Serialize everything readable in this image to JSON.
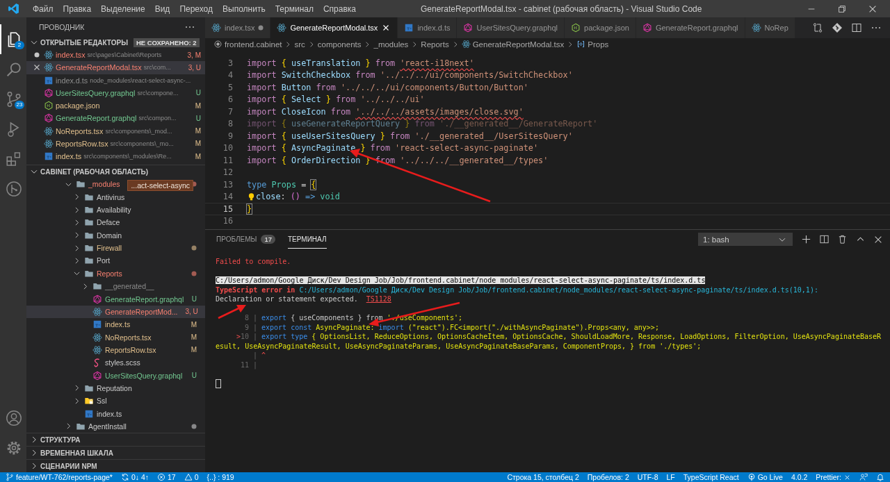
{
  "window": {
    "title": "GenerateReportModal.tsx - cabinet (рабочая область) - Visual Studio Code",
    "menu": [
      "Файл",
      "Правка",
      "Выделение",
      "Вид",
      "Переход",
      "Выполнить",
      "Терминал",
      "Справка"
    ]
  },
  "activity_bar": {
    "items": [
      {
        "selected": true,
        "badge": "2"
      },
      {
        "selected": false
      },
      {
        "selected": false,
        "badge": "23"
      },
      {
        "selected": false
      },
      {
        "selected": false
      },
      {
        "selected": false
      }
    ]
  },
  "explorer": {
    "title": "ПРОВОДНИК",
    "open_editors": {
      "title": "ОТКРЫТЫЕ РЕДАКТОРЫ",
      "expanded": true,
      "unsaved_badge": "НЕ СОХРАНЕНО: 2",
      "items": [
        {
          "name": "index.tsx",
          "path": "src\\pages\\Cabinet\\Reports",
          "kind": "react",
          "color": "#f88070",
          "badge": "3, M",
          "dirty": true,
          "selected": false
        },
        {
          "name": "GenerateReportModal.tsx",
          "path": "src\\com...",
          "kind": "react",
          "color": "#f88070",
          "badge": "3, U",
          "dirty": false,
          "selected": true
        },
        {
          "name": "index.d.ts",
          "path": "node_modules\\react-select-async-...",
          "kind": "ts",
          "color": "#8c8c8c",
          "dirty": false,
          "selected": false
        },
        {
          "name": "UserSitesQuery.graphql",
          "path": "src\\compone...",
          "kind": "graphql",
          "color": "#73c991",
          "badge": "U",
          "dirty": false,
          "selected": false
        },
        {
          "name": "package.json",
          "kind": "json",
          "color": "#e2c08d",
          "badge": "M",
          "dirty": false,
          "selected": false
        },
        {
          "name": "GenerateReport.graphql",
          "path": "src\\compon...",
          "kind": "graphql",
          "color": "#73c991",
          "badge": "U",
          "dirty": false,
          "selected": false
        },
        {
          "name": "NoReports.tsx",
          "path": "src\\components\\_mod...",
          "kind": "react",
          "color": "#e2c08d",
          "badge": "M",
          "dirty": false,
          "selected": false
        },
        {
          "name": "ReportsRow.tsx",
          "path": "src\\components\\_mo...",
          "kind": "react",
          "color": "#e2c08d",
          "badge": "M",
          "dirty": false,
          "selected": false
        },
        {
          "name": "index.ts",
          "path": "src\\components\\_modules\\Re...",
          "kind": "ts",
          "color": "#e2c08d",
          "badge": "M",
          "dirty": false,
          "selected": false
        }
      ]
    },
    "workspace": {
      "title": "CABINET (РАБОЧАЯ ОБЛАСТЬ)",
      "expanded": true,
      "tooltip": "...act-select-async",
      "tree": [
        {
          "label": "_modules",
          "kind": "folder",
          "color": "#f88070",
          "dot": true,
          "expanded": true,
          "selected": false,
          "children": [
            {
              "label": "Antivirus",
              "kind": "folder",
              "color": "#cccccc",
              "dot": false,
              "expanded": false,
              "selected": false
            },
            {
              "label": "Availability",
              "kind": "folder",
              "color": "#cccccc",
              "dot": false,
              "expanded": false,
              "selected": false
            },
            {
              "label": "Deface",
              "kind": "folder",
              "color": "#cccccc",
              "dot": false,
              "expanded": false,
              "selected": false
            },
            {
              "label": "Domain",
              "kind": "folder",
              "color": "#cccccc",
              "dot": false,
              "expanded": false,
              "selected": false
            },
            {
              "label": "Firewall",
              "kind": "folder",
              "color": "#e2c08d",
              "dot": true,
              "expanded": false,
              "selected": false
            },
            {
              "label": "Port",
              "kind": "folder",
              "color": "#cccccc",
              "dot": false,
              "expanded": false,
              "selected": false
            },
            {
              "label": "Reports",
              "kind": "folder",
              "color": "#f88070",
              "dot": true,
              "expanded": true,
              "selected": false,
              "children": [
                {
                  "label": "__generated__",
                  "kind": "folder",
                  "color": "#8c8c8c",
                  "dot": false,
                  "expanded": false,
                  "selected": false
                },
                {
                  "label": "GenerateReport.graphql",
                  "kind": "graphql",
                  "color": "#73c991",
                  "badge": "U",
                  "selected": false
                },
                {
                  "label": "GenerateReportMod...",
                  "kind": "react",
                  "color": "#f88070",
                  "badge": "3, U",
                  "selected": true
                },
                {
                  "label": "index.ts",
                  "kind": "ts",
                  "color": "#e2c08d",
                  "badge": "M",
                  "selected": false
                },
                {
                  "label": "NoReports.tsx",
                  "kind": "react",
                  "color": "#e2c08d",
                  "badge": "M",
                  "selected": false
                },
                {
                  "label": "ReportsRow.tsx",
                  "kind": "react",
                  "color": "#e2c08d",
                  "badge": "M",
                  "selected": false
                },
                {
                  "label": "styles.scss",
                  "kind": "scss",
                  "color": "#cccccc",
                  "selected": false
                },
                {
                  "label": "UserSitesQuery.graphql",
                  "kind": "graphql",
                  "color": "#73c991",
                  "badge": "U",
                  "selected": false
                }
              ]
            },
            {
              "label": "Reputation",
              "kind": "folder",
              "color": "#cccccc",
              "dot": false,
              "expanded": false,
              "selected": false
            },
            {
              "label": "Ssl",
              "kind": "folder-lock",
              "color": "#cccccc",
              "dot": false,
              "expanded": false,
              "selected": false
            },
            {
              "label": "index.ts",
              "kind": "ts",
              "color": "#cccccc",
              "selected": false
            }
          ]
        },
        {
          "label": "AgentInstall",
          "kind": "folder",
          "color": "#cccccc",
          "dot": true,
          "expanded": false,
          "selected": false
        }
      ]
    },
    "sections": [
      {
        "title": "СТРУКТУРА",
        "expanded": false
      },
      {
        "title": "ВРЕМЕННАЯ ШКАЛА",
        "expanded": false
      },
      {
        "title": "СЦЕНАРИИ NPM",
        "expanded": false
      }
    ]
  },
  "tabs": [
    {
      "label": "index.tsx",
      "kind": "react",
      "dirty": true,
      "selected": false
    },
    {
      "label": "GenerateReportModal.tsx",
      "kind": "react",
      "dirty": false,
      "selected": true
    },
    {
      "label": "index.d.ts",
      "kind": "ts",
      "dirty": false,
      "selected": false
    },
    {
      "label": "UserSitesQuery.graphql",
      "kind": "graphql",
      "dirty": false,
      "selected": false
    },
    {
      "label": "package.json",
      "kind": "json",
      "dirty": false,
      "selected": false
    },
    {
      "label": "GenerateReport.graphql",
      "kind": "graphql",
      "dirty": false,
      "selected": false
    },
    {
      "label": "NoRep",
      "kind": "react",
      "dirty": false,
      "selected": false
    }
  ],
  "breadcrumb": [
    {
      "label": "frontend.cabinet",
      "kind": "workspace"
    },
    {
      "label": "src",
      "kind": "folder"
    },
    {
      "label": "components",
      "kind": "folder"
    },
    {
      "label": "_modules",
      "kind": "folder"
    },
    {
      "label": "Reports",
      "kind": "folder"
    },
    {
      "label": "GenerateReportModal.tsx",
      "kind": "react"
    },
    {
      "label": "Props",
      "kind": "symbol"
    }
  ],
  "code": [
    {
      "number": "3",
      "tokens": [
        {
          "text": "import ",
          "kind": "kw"
        },
        {
          "text": "{ ",
          "kind": "brace"
        },
        {
          "text": "useTranslation ",
          "kind": "id"
        },
        {
          "text": "} ",
          "kind": "brace"
        },
        {
          "text": "from ",
          "kind": "kw"
        },
        {
          "text": "'react-i18next'",
          "kind": "str-err"
        }
      ]
    },
    {
      "number": "4",
      "tokens": [
        {
          "text": "import ",
          "kind": "kw"
        },
        {
          "text": "SwitchCheckbox ",
          "kind": "id"
        },
        {
          "text": "from ",
          "kind": "kw"
        },
        {
          "text": "'../../../ui/components/SwitchCheckbox'",
          "kind": "str"
        }
      ]
    },
    {
      "number": "5",
      "tokens": [
        {
          "text": "import ",
          "kind": "kw"
        },
        {
          "text": "Button ",
          "kind": "id"
        },
        {
          "text": "from ",
          "kind": "kw"
        },
        {
          "text": "'../../../ui/components/Button/Button'",
          "kind": "str"
        }
      ]
    },
    {
      "number": "6",
      "tokens": [
        {
          "text": "import ",
          "kind": "kw"
        },
        {
          "text": "{ ",
          "kind": "brace"
        },
        {
          "text": "Select ",
          "kind": "id"
        },
        {
          "text": "} ",
          "kind": "brace"
        },
        {
          "text": "from ",
          "kind": "kw"
        },
        {
          "text": "'../../../ui'",
          "kind": "str"
        }
      ]
    },
    {
      "number": "7",
      "tokens": [
        {
          "text": "import ",
          "kind": "kw"
        },
        {
          "text": "CloseIcon ",
          "kind": "id"
        },
        {
          "text": "from ",
          "kind": "kw"
        },
        {
          "text": "'../../../assets/images/close.svg'",
          "kind": "str-err"
        }
      ]
    },
    {
      "number": "8",
      "faded": true,
      "tokens": [
        {
          "text": "import ",
          "kind": "kw"
        },
        {
          "text": "{ ",
          "kind": "brace"
        },
        {
          "text": "useGenerateReportQuery ",
          "kind": "id"
        },
        {
          "text": "} ",
          "kind": "brace"
        },
        {
          "text": "from ",
          "kind": "kw"
        },
        {
          "text": "'./__generated__/GenerateReport'",
          "kind": "str"
        }
      ]
    },
    {
      "number": "9",
      "tokens": [
        {
          "text": "import ",
          "kind": "kw"
        },
        {
          "text": "{ ",
          "kind": "brace"
        },
        {
          "text": "useUserSitesQuery ",
          "kind": "id"
        },
        {
          "text": "} ",
          "kind": "brace"
        },
        {
          "text": "from ",
          "kind": "kw"
        },
        {
          "text": "'./__generated__/UserSitesQuery'",
          "kind": "str"
        }
      ]
    },
    {
      "number": "10",
      "tokens": [
        {
          "text": "import ",
          "kind": "kw"
        },
        {
          "text": "{ ",
          "kind": "brace"
        },
        {
          "text": "AsyncPaginate ",
          "kind": "id"
        },
        {
          "text": "} ",
          "kind": "brace"
        },
        {
          "text": "from ",
          "kind": "kw"
        },
        {
          "text": "'react-select-async-paginate'",
          "kind": "str"
        }
      ]
    },
    {
      "number": "11",
      "tokens": [
        {
          "text": "import ",
          "kind": "kw"
        },
        {
          "text": "{ ",
          "kind": "brace"
        },
        {
          "text": "OrderDirection ",
          "kind": "id"
        },
        {
          "text": "} ",
          "kind": "brace"
        },
        {
          "text": "from ",
          "kind": "kw"
        },
        {
          "text": "'../../../__generated__/types'",
          "kind": "str"
        }
      ]
    },
    {
      "number": "12"
    },
    {
      "number": "13",
      "tokens": [
        {
          "text": "type ",
          "kind": "decl"
        },
        {
          "text": "Props ",
          "kind": "type"
        },
        {
          "text": "= ",
          "kind": "op"
        },
        {
          "text": "{",
          "kind": "brace-match"
        }
      ]
    },
    {
      "number": "14",
      "lightbulb": true,
      "tokens": [
        {
          "text": "close",
          "kind": "id"
        },
        {
          "text": ": ",
          "kind": "op"
        },
        {
          "text": "() ",
          "kind": "paren"
        },
        {
          "text": "=> ",
          "kind": "decl"
        },
        {
          "text": "void",
          "kind": "type"
        }
      ]
    },
    {
      "number": "15",
      "current": true,
      "tokens": [
        {
          "text": "}",
          "kind": "brace-match"
        }
      ]
    },
    {
      "number": "16"
    }
  ],
  "panel": {
    "tabs": [
      {
        "label": "ПРОБЛЕМЫ",
        "badge": "17",
        "selected": false
      },
      {
        "label": "ТЕРМИНАЛ",
        "selected": true
      }
    ],
    "terminal_select": "1: bash",
    "terminal": {
      "cursor": true,
      "blocks": [
        {
          "lines": [
            {
              "segments": [
                {
                  "text": "Failed to compile.",
                  "kind": "fail"
                }
              ]
            }
          ]
        },
        {
          "lines": [
            {
              "segments": [
                {
                  "text": "C:/Users/admon/Google Диск/Dev Design Job/Job/frontend.cabinet/node_modules/react-select-async-paginate/ts/index.d.ts",
                  "kind": "highlight"
                }
              ]
            },
            {
              "segments": [
                {
                  "text": "TypeScript error in",
                  "kind": "fail-bold"
                },
                {
                  "text": "C:/Users/admon/Google Диск/Dev Design Job/Job/frontend.cabinet/node_modules/react-select-async-paginate/ts/index.d.ts(10,1):",
                  "kind": "path"
                }
              ]
            },
            {
              "segments": [
                {
                  "text": "Declaration or statement expected.",
                  "kind": "plain"
                },
                {
                  "text": "TS1128",
                  "kind": "code"
                }
              ]
            }
          ]
        },
        {
          "lines": [
            {
              "segments": [
                {
                  "text": "8 |",
                  "kind": "gutter"
                },
                {
                  "text": "export",
                  "kind": "tkw"
                },
                {
                  "text": "{ useComponents } from",
                  "kind": "plain"
                },
                {
                  "text": "'./useComponents';",
                  "kind": "tstr"
                }
              ]
            },
            {
              "segments": [
                {
                  "text": "9 |",
                  "kind": "gutter"
                },
                {
                  "text": "export const",
                  "kind": "tkw"
                },
                {
                  "text": "AsyncPaginate:",
                  "kind": "tid"
                },
                {
                  "text": "import",
                  "kind": "tkw"
                },
                {
                  "text": "(\"react\").FC<import(\"./withAsyncPaginate\").Props<any, any>>;",
                  "kind": "tstr"
                }
              ]
            },
            {
              "marker": ">",
              "segments": [
                {
                  "text": "10 |",
                  "kind": "gutter"
                },
                {
                  "text": "export type",
                  "kind": "tkw"
                },
                {
                  "text": "{ OptionsList, ReduceOptions, OptionsCacheItem, OptionsCache, ShouldLoadMore, Response, LoadOptions, FilterOption, UseAsyncPaginateBaseResult, UseAsyncPaginateResult, UseAsyncPaginateParams, UseAsyncPaginateBaseParams, ComponentProps, } from './types';",
                  "kind": "tid"
                }
              ]
            },
            {
              "segments": [
                {
                  "text": "|",
                  "kind": "gutter"
                },
                {
                  "text": "^",
                  "kind": "marker"
                }
              ]
            },
            {
              "segments": [
                {
                  "text": "11 |",
                  "kind": "gutter"
                }
              ]
            }
          ]
        }
      ]
    }
  },
  "status_bar": {
    "left": [
      {
        "kind": "branch",
        "text": "feature/WT-762/reports-page*"
      },
      {
        "kind": "sync",
        "text": "0↓ 4↑"
      },
      {
        "kind": "errors",
        "text": "17"
      },
      {
        "kind": "warnings",
        "text": "0"
      },
      {
        "kind": "text",
        "text": "{..} : 919"
      }
    ],
    "right": [
      {
        "kind": "text",
        "text": "Строка 15, столбец 2"
      },
      {
        "kind": "text",
        "text": "Пробелов: 2"
      },
      {
        "kind": "text",
        "text": "UTF-8"
      },
      {
        "kind": "text",
        "text": "LF"
      },
      {
        "kind": "text",
        "text": "TypeScript React"
      },
      {
        "kind": "live",
        "text": "Go Live"
      },
      {
        "kind": "text",
        "text": "4.0.2"
      },
      {
        "kind": "prettier",
        "text": "Prettier:"
      },
      {
        "kind": "feedback"
      },
      {
        "kind": "bell"
      }
    ]
  }
}
